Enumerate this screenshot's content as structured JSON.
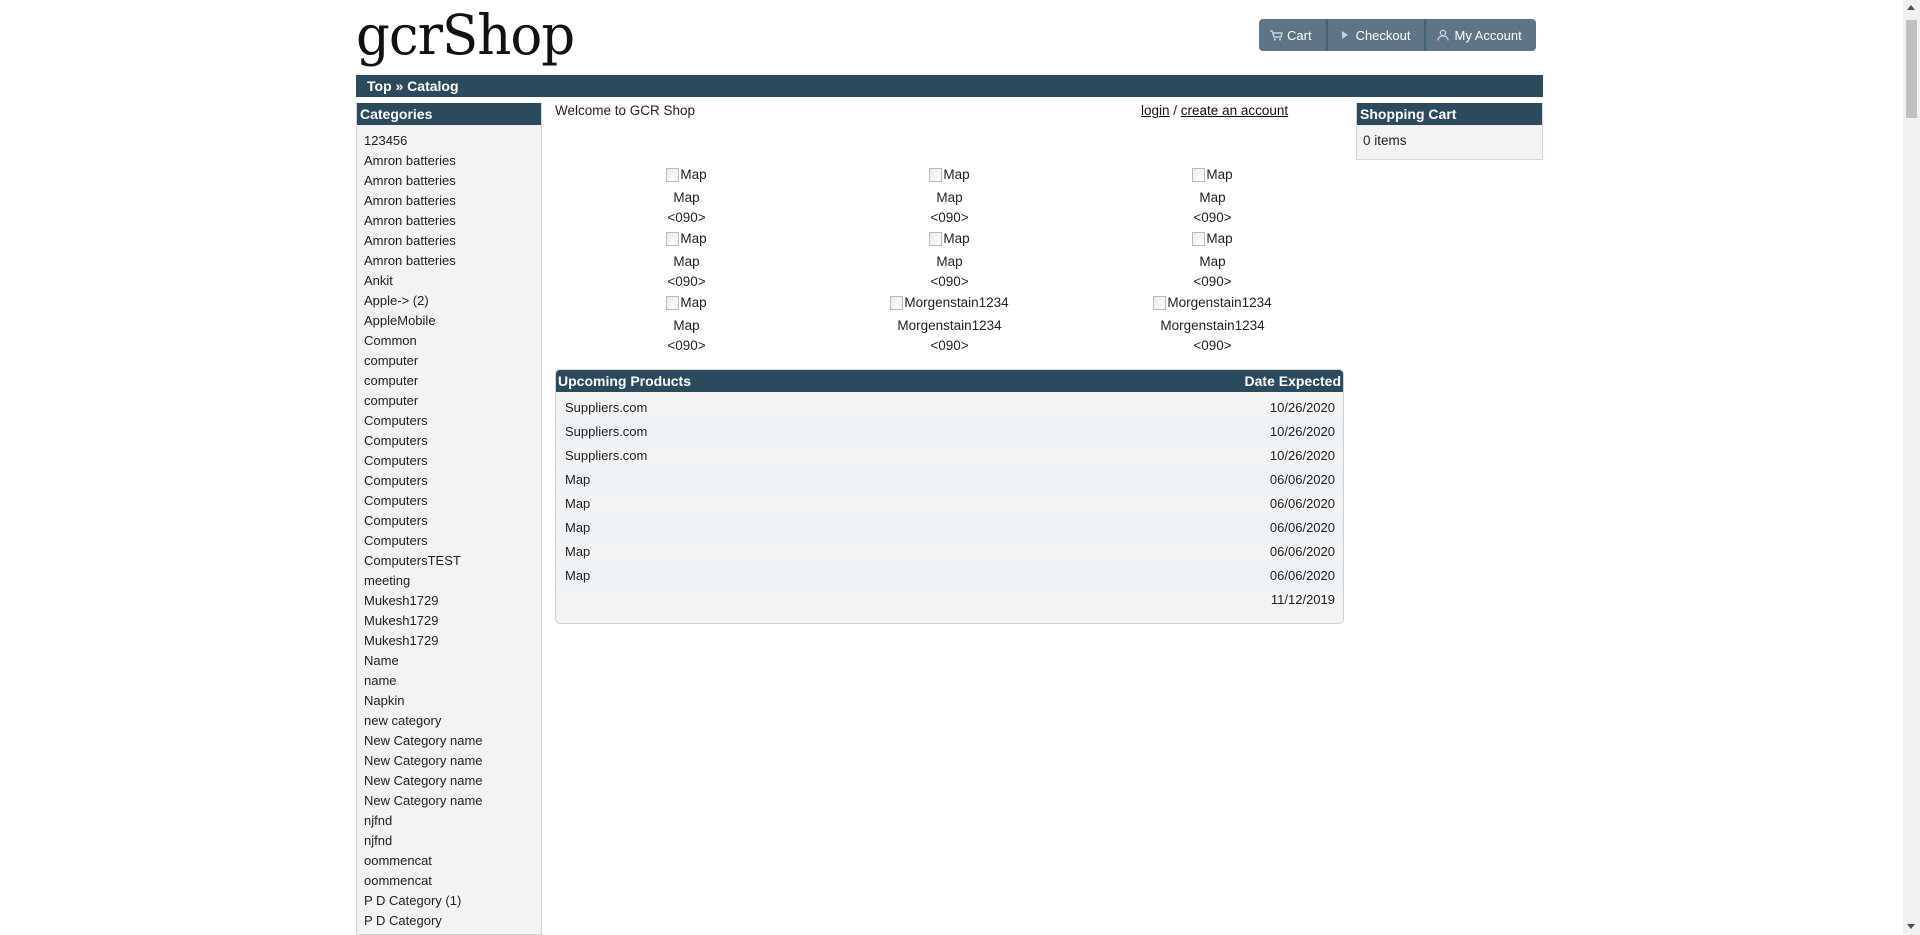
{
  "logo": "gcrShop",
  "nav": {
    "cart": "Cart",
    "checkout": "Checkout",
    "account": "My Account"
  },
  "breadcrumb": "Top » Catalog",
  "categories": {
    "title": "Categories",
    "items": [
      "123456",
      "Amron batteries",
      "Amron batteries",
      "Amron batteries",
      "Amron batteries",
      "Amron batteries",
      "Amron batteries",
      "Ankit",
      "Apple-> (2)",
      "AppleMobile",
      "Common",
      "computer",
      "computer",
      "computer",
      "Computers",
      "Computers",
      "Computers",
      "Computers",
      "Computers",
      "Computers",
      "Computers",
      "ComputersTEST",
      "meeting",
      "Mukesh1729",
      "Mukesh1729",
      "Mukesh1729",
      "Name",
      "name",
      "Napkin",
      "new category",
      "New Category name",
      "New Category name",
      "New Category name",
      "New Category name",
      "njfnd",
      "njfnd",
      "oommencat",
      "oommencat",
      "P D Category (1)",
      "P D Category"
    ]
  },
  "welcome": "Welcome to GCR Shop",
  "account_links": {
    "login": "login",
    "sep": " / ",
    "create": "create an account"
  },
  "products": [
    {
      "alt": "Map",
      "name": "Map",
      "price": "<090>"
    },
    {
      "alt": "Map",
      "name": "Map",
      "price": "<090>"
    },
    {
      "alt": "Map",
      "name": "Map",
      "price": "<090>"
    },
    {
      "alt": "Map",
      "name": "Map",
      "price": "<090>"
    },
    {
      "alt": "Map",
      "name": "Map",
      "price": "<090>"
    },
    {
      "alt": "Map",
      "name": "Map",
      "price": "<090>"
    },
    {
      "alt": "Map",
      "name": "Map",
      "price": "<090>"
    },
    {
      "alt": "Morgenstain1234",
      "name": "Morgenstain1234",
      "price": "<090>"
    },
    {
      "alt": "Morgenstain1234",
      "name": "Morgenstain1234",
      "price": "<090>"
    }
  ],
  "upcoming": {
    "title": "Upcoming Products",
    "date_header": "Date Expected",
    "rows": [
      {
        "name": "Suppliers.com",
        "date": "10/26/2020"
      },
      {
        "name": "Suppliers.com",
        "date": "10/26/2020"
      },
      {
        "name": "Suppliers.com",
        "date": "10/26/2020"
      },
      {
        "name": "Map",
        "date": "06/06/2020"
      },
      {
        "name": "Map",
        "date": "06/06/2020"
      },
      {
        "name": "Map",
        "date": "06/06/2020"
      },
      {
        "name": "Map",
        "date": "06/06/2020"
      },
      {
        "name": "Map",
        "date": "06/06/2020"
      },
      {
        "name": "",
        "date": "11/12/2019"
      }
    ]
  },
  "cart": {
    "title": "Shopping Cart",
    "items": "0 items"
  }
}
